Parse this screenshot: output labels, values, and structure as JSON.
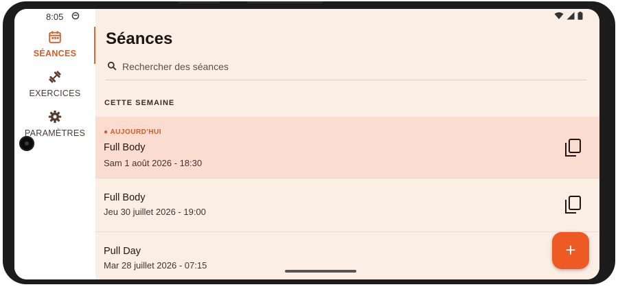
{
  "status_bar": {
    "time": "8:05"
  },
  "nav_rail": {
    "items": [
      {
        "label": "SÉANCES",
        "icon": "calendar-icon",
        "active": true
      },
      {
        "label": "EXERCICES",
        "icon": "dumbbell-icon",
        "active": false
      },
      {
        "label": "PARAMÈTRES",
        "icon": "gear-icon",
        "active": false
      }
    ]
  },
  "main": {
    "title": "Séances",
    "search": {
      "placeholder": "Rechercher des séances",
      "value": ""
    },
    "section_header": "CETTE SEMAINE",
    "sessions": [
      {
        "tag": "● AUJOURD'HUI",
        "title": "Full Body",
        "date": "Sam 1 août 2026 - 18:30"
      },
      {
        "title": "Full Body",
        "date": "Jeu 30 juillet 2026 - 19:00"
      },
      {
        "title": "Pull Day",
        "date": "Mar 28 juillet 2026 - 07:15"
      }
    ],
    "fab_label": "+"
  },
  "colors": {
    "accent": "#e2632f",
    "fab": "#ee5a24",
    "background": "#fbeee4",
    "today_highlight": "#fbdcd0",
    "text_primary": "#1d1410"
  }
}
